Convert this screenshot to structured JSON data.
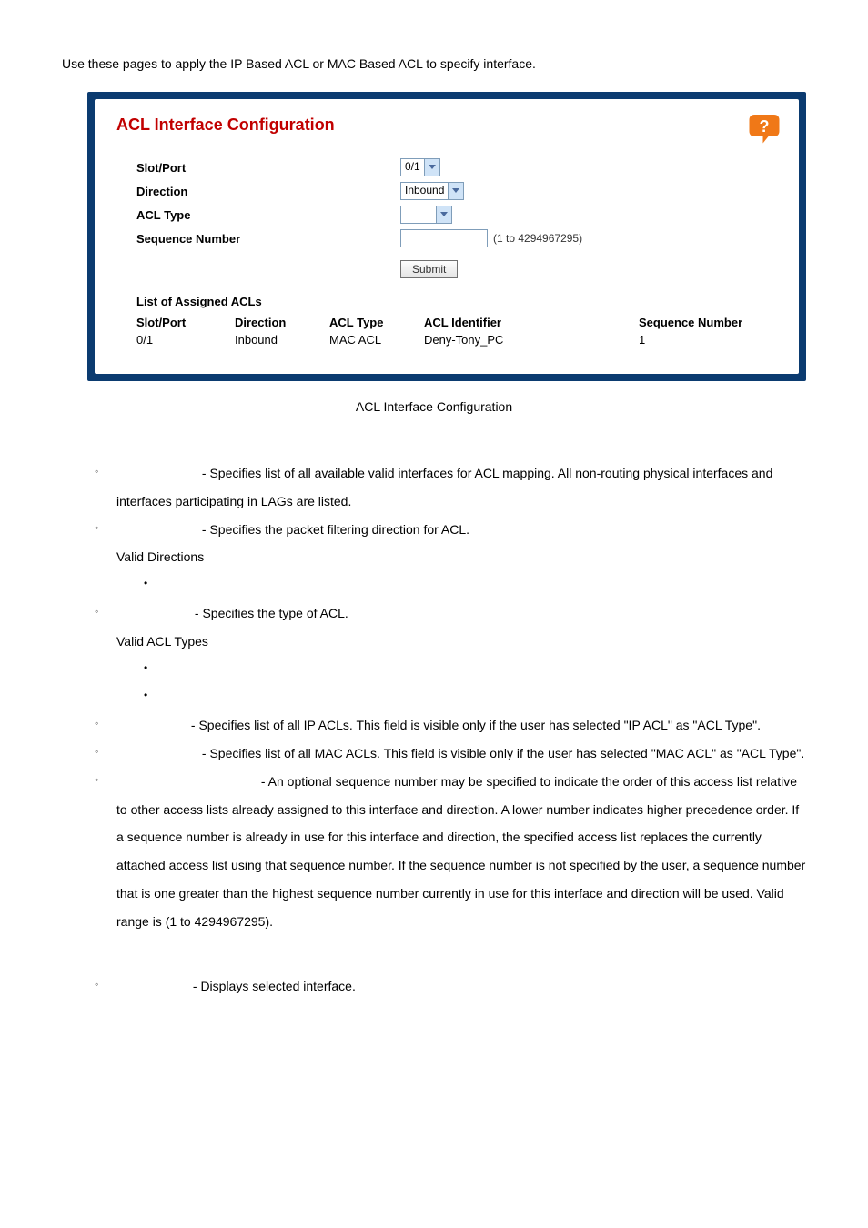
{
  "intro": "Use these pages to apply the IP Based ACL or MAC Based ACL to specify interface.",
  "panel": {
    "title": "ACL Interface Configuration",
    "form": {
      "slot_port": {
        "label": "Slot/Port",
        "value": "0/1"
      },
      "direction": {
        "label": "Direction",
        "value": "Inbound"
      },
      "acl_type": {
        "label": "ACL Type",
        "value": ""
      },
      "seq_num": {
        "label": "Sequence Number",
        "value": "",
        "hint": "(1 to 4294967295)"
      },
      "submit": "Submit"
    },
    "assigned": {
      "title": "List of Assigned ACLs",
      "headers": {
        "c1": "Slot/Port",
        "c2": "Direction",
        "c3": "ACL Type",
        "c4": "ACL Identifier",
        "c5": "Sequence Number"
      },
      "rows": [
        {
          "c1": "0/1",
          "c2": "Inbound",
          "c3": "MAC ACL",
          "c4": "Deny-Tony_PC",
          "c5": "1"
        }
      ]
    }
  },
  "caption": "ACL Interface Configuration",
  "bullets": {
    "b1": " - Specifies list of all available valid interfaces for ACL mapping. All non-routing physical interfaces and interfaces participating in LAGs are listed.",
    "b2": " - Specifies the packet filtering direction for ACL.",
    "b2_sub": "Valid Directions",
    "b3": " - Specifies the type of ACL.",
    "b3_sub": "Valid ACL Types",
    "b4": " - Specifies list of all IP ACLs. This field is visible only if the user has selected \"IP ACL\" as \"ACL Type\".",
    "b5": " - Specifies list of all MAC ACLs. This field is visible only if the user has selected \"MAC ACL\" as \"ACL Type\".",
    "b6": " - An optional sequence number may be specified to indicate the order of this access list relative to other access lists already assigned to this interface and direction. A lower number indicates higher precedence order. If a sequence number is already in use for this interface and direction, the specified access list replaces the currently attached access list using that sequence number. If the sequence number is not specified by the user, a sequence number that is one greater than the highest sequence number currently in use for this interface and direction will be used. Valid range is (1 to 4294967295).",
    "b7": " - Displays selected interface."
  }
}
